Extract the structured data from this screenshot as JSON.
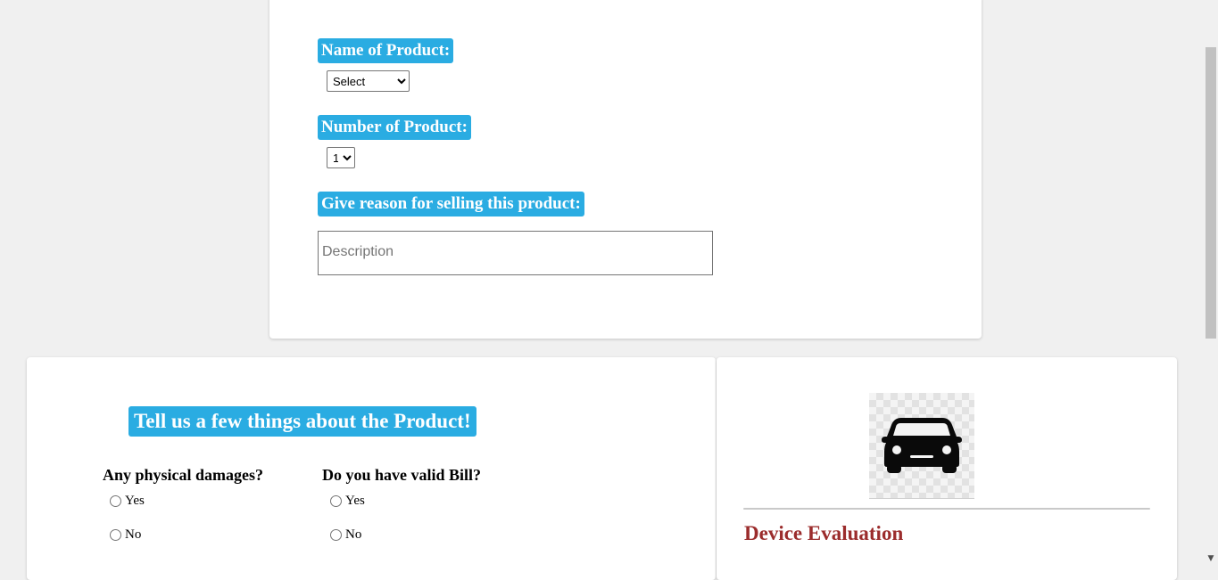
{
  "form": {
    "name_label": "Name of Product:",
    "name_select_value": "Select",
    "number_label": "Number of Product:",
    "number_select_value": "1",
    "reason_label": "Give reason for selling this product:",
    "description_placeholder": "Description"
  },
  "product_info": {
    "heading": "Tell us a few things about the Product!",
    "questions": [
      {
        "title": "Any physical damages?",
        "options": [
          "Yes",
          "No"
        ]
      },
      {
        "title": "Do you have valid Bill?",
        "options": [
          "Yes",
          "No"
        ]
      }
    ]
  },
  "evaluation": {
    "icon": "car-icon",
    "title": "Device Evaluation"
  },
  "colors": {
    "accent": "#2aace2",
    "evaluation_title": "#9b2c2c",
    "background": "#f0f0f0"
  }
}
